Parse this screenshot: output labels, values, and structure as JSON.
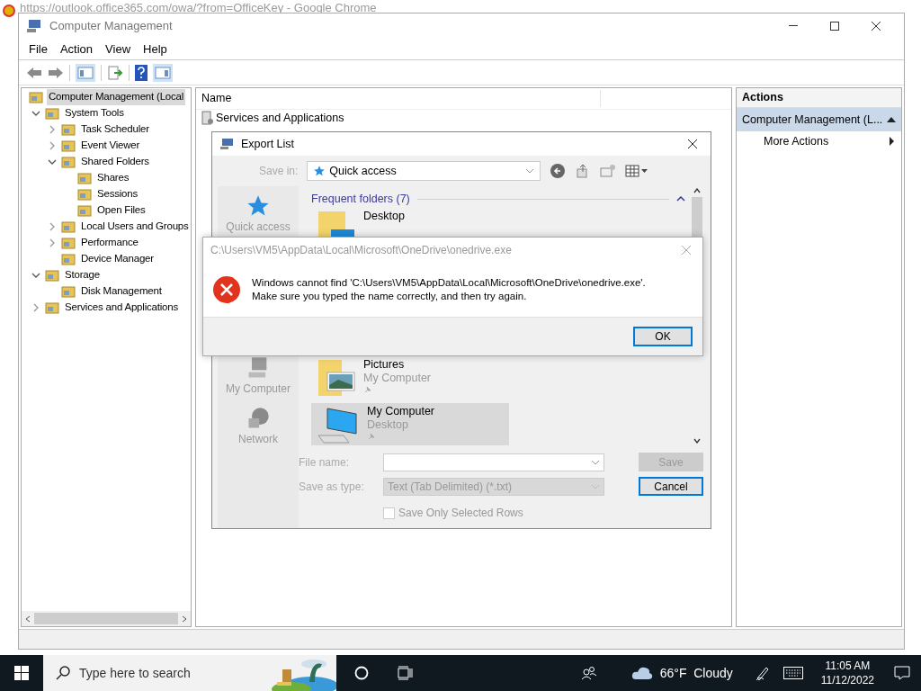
{
  "browser_behind": {
    "title": "https://outlook.office365.com/owa/?from=OfficeKey - Google Chrome"
  },
  "window": {
    "title": "Computer Management"
  },
  "menu": [
    "File",
    "Action",
    "View",
    "Help"
  ],
  "tree": [
    {
      "label": "Computer Management (Local",
      "selected": true,
      "children": [
        {
          "label": "System Tools",
          "selected": false,
          "expanded": true,
          "children": [
            {
              "label": "Task Scheduler",
              "selected": false,
              "expanded": false
            },
            {
              "label": "Event Viewer",
              "selected": false,
              "expanded": false
            },
            {
              "label": "Shared Folders",
              "selected": false,
              "expanded": true,
              "children": [
                {
                  "label": "Shares",
                  "selected": false
                },
                {
                  "label": "Sessions",
                  "selected": false
                },
                {
                  "label": "Open Files",
                  "selected": false
                }
              ]
            },
            {
              "label": "Local Users and Groups",
              "selected": false,
              "expanded": false
            },
            {
              "label": "Performance",
              "selected": false,
              "expanded": false
            },
            {
              "label": "Device Manager",
              "selected": false
            }
          ]
        },
        {
          "label": "Storage",
          "selected": false,
          "expanded": true,
          "children": [
            {
              "label": "Disk Management",
              "selected": false
            }
          ]
        },
        {
          "label": "Services and Applications",
          "selected": false,
          "expanded": false
        }
      ]
    }
  ],
  "list": {
    "columns": [
      "Name"
    ],
    "rows": [
      "Services and Applications"
    ]
  },
  "actions": {
    "title": "Actions",
    "section": "Computer Management (L...",
    "items": [
      "More Actions"
    ]
  },
  "export_dialog": {
    "title": "Export List",
    "save_in_label": "Save in:",
    "save_in": "Quick access",
    "places": [
      {
        "label": "Quick access",
        "kind": "star"
      },
      {
        "label": "My Computer",
        "kind": "computer"
      },
      {
        "label": "Network",
        "kind": "network"
      }
    ],
    "group": "Frequent folders (7)",
    "items": [
      {
        "name": "Desktop",
        "kind": "desktop",
        "selected": false
      },
      {
        "name": "Pictures",
        "location": "My Computer",
        "kind": "pictures",
        "selected": false
      },
      {
        "name": "My Computer",
        "location": "Desktop",
        "kind": "computer",
        "selected": true
      }
    ],
    "file_name_label": "File name:",
    "save_type_label": "Save as type:",
    "save_type": "Text (Tab Delimited) (*.txt)",
    "save_button": {
      "label": "Save",
      "disabled": true
    },
    "cancel_button": "Cancel",
    "checkbox": {
      "label": "Save Only Selected Rows",
      "checked": false
    }
  },
  "error_dialog": {
    "title": "C:\\Users\\VM5\\AppData\\Local\\Microsoft\\OneDrive\\onedrive.exe",
    "message": [
      "Windows cannot find 'C:\\Users\\VM5\\AppData\\Local\\Microsoft\\OneDrive\\onedrive.exe'.",
      "Make sure you typed the name correctly, and then try again."
    ],
    "ok": "OK"
  },
  "taskbar": {
    "search_placeholder": "Type here to search",
    "weather": "66°F  Cloudy",
    "time": "11:05 AM",
    "date": "11/12/2022"
  }
}
